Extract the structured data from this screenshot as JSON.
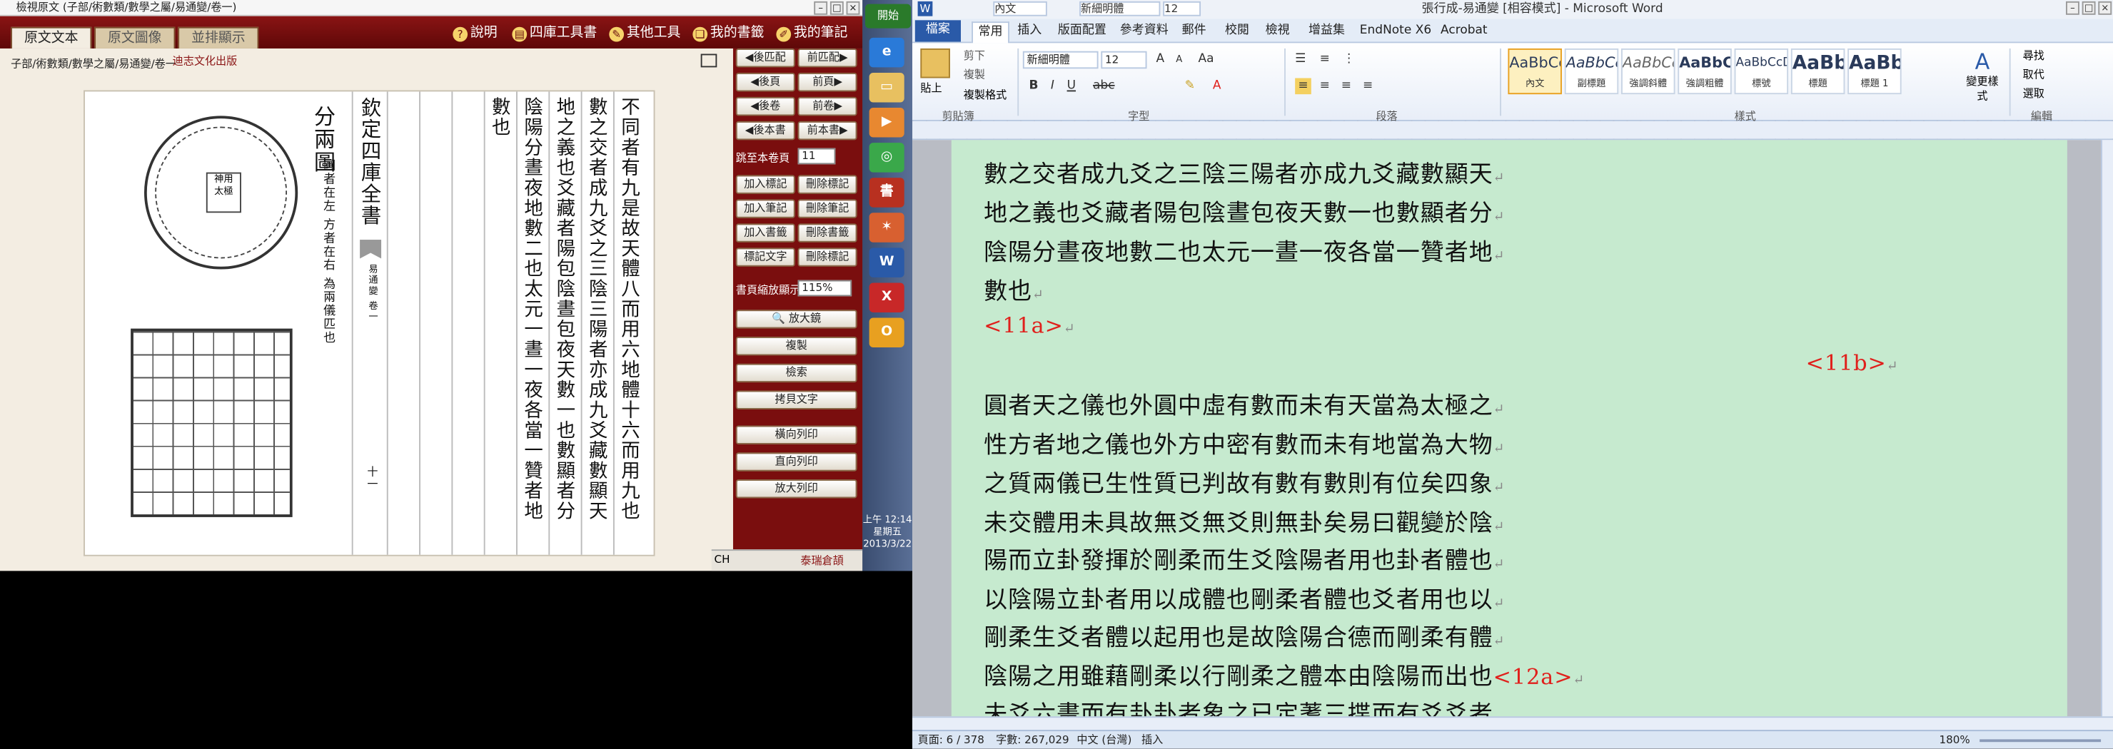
{
  "viewer": {
    "title": "檢視原文 (子部/術數類/數學之屬/易通變/卷一)",
    "tabs": [
      "原文文本",
      "原文圖像",
      "並排顯示"
    ],
    "menu": [
      {
        "icon": "help-icon",
        "label": "說明"
      },
      {
        "icon": "book-icon",
        "label": "四庫工具書"
      },
      {
        "icon": "tool-icon",
        "label": "其他工具"
      },
      {
        "icon": "bookshelf-icon",
        "label": "我的書籤"
      },
      {
        "icon": "note-icon",
        "label": "我的筆記"
      }
    ],
    "breadcrumb": "子部/術數類/數學之屬/易通變/卷一",
    "logo": "迪志文化出版",
    "page": {
      "diagram_title": "分兩圖",
      "diagram_note": "圓者在左 方者在右 為兩儀匹也",
      "seal_text": "欽定四庫全書",
      "juan_label": "易通變 卷一",
      "page_number": "十一",
      "columns": [
        "不同者有九是故天體八而用六地體十六而用九也",
        "數之交者成九爻之三陰三陽者亦成九爻藏數顯天",
        "地之義也爻藏者陽包陰晝包夜天數一也數顯者分",
        "陰陽分晝夜地數二也太元一晝一夜各當一贊者地",
        "數也"
      ]
    },
    "side": {
      "prev_match": "後匹配",
      "next_match": "前匹配",
      "prev_page": "後頁",
      "next_page": "前頁",
      "prev_juan": "後卷",
      "next_juan": "前卷",
      "prev_book": "後本書",
      "next_book": "前本書",
      "goto_label": "跳至本卷頁",
      "goto_value": "11",
      "add_bookmark": "加入標記",
      "del_bookmark": "刪除標記",
      "add_note": "加入筆記",
      "del_note": "刪除筆記",
      "add_shelf": "加入書籤",
      "del_shelf": "刪除書籤",
      "mark_text": "標記文字",
      "del_mark": "刪除標記",
      "zoom_label": "書頁縮放顯示",
      "zoom_value": "115%",
      "magnifier": "放大鏡",
      "copy": "複製",
      "search": "檢索",
      "copy_text": "拷貝文字",
      "print_h": "橫向列印",
      "print_v": "直向列印",
      "print_zoom": "放大列印"
    },
    "status": {
      "lang": "CH",
      "ime": "泰瑞倉頡"
    }
  },
  "taskbar": {
    "start": "開始",
    "clock_time": "上午 12:14",
    "clock_day": "星期五",
    "clock_date": "2013/3/22"
  },
  "word": {
    "title": "張行成-易通變 [相容模式] - Microsoft Word",
    "qat_style": "內文",
    "qat_font": "新細明體",
    "qat_size": "12",
    "tabs": [
      "檔案",
      "常用",
      "插入",
      "版面配置",
      "參考資料",
      "郵件",
      "校閱",
      "檢視",
      "增益集",
      "EndNote X6",
      "Acrobat"
    ],
    "clipboard": {
      "paste": "貼上",
      "cut": "剪下",
      "copy": "複製",
      "format": "複製格式",
      "group": "剪貼簿"
    },
    "font": {
      "name": "新細明體",
      "size": "12",
      "group": "字型"
    },
    "paragraph_group": "段落",
    "styles": [
      {
        "preview": "AaBbCcI",
        "name": "內文"
      },
      {
        "preview": "AaBbCcL",
        "name": "副標題"
      },
      {
        "preview": "AaBbCcL",
        "name": "強調斜體"
      },
      {
        "preview": "AaBbCcI",
        "name": "強調粗體"
      },
      {
        "preview": "AaBbCcDd",
        "name": "標號"
      },
      {
        "preview": "AaBb",
        "name": "標題"
      },
      {
        "preview": "AaBb",
        "name": "標題 1"
      }
    ],
    "styles_group": "樣式",
    "change_styles": "變更樣式",
    "editing": {
      "find": "尋找",
      "replace": "取代",
      "select": "選取",
      "group": "編輯"
    },
    "doc_lines": [
      "數之交者成九爻之三陰三陽者亦成九爻藏數顯天",
      "地之義也爻藏者陽包陰晝包夜天數一也數顯者分",
      "陰陽分晝夜地數二也太元一晝一夜各當一贊者地",
      "數也"
    ],
    "marker_11a": "<11a>",
    "marker_11b": "<11b>",
    "doc_lines2": [
      "圓者天之儀也外圓中虛有數而未有天當為太極之",
      "性方者地之儀也外方中密有數而未有地當為大物",
      "之質兩儀已生性質已判故有數有數則有位矣四象",
      "未交體用未具故無爻無爻則無卦矣易曰觀變於陰",
      "陽而立卦發揮於剛柔而生爻陰陽者用也卦者體也",
      "以陰陽立卦者用以成體也剛柔者體也爻者用也以",
      "剛柔生爻者體以起用也是故陰陽合德而剛柔有體",
      "陰陽之用雖藉剛柔以行剛柔之體本由陰陽而出也",
      "未爻六畫而有卦卦者象之已定蓍三揲而有爻爻者"
    ],
    "marker_12a": "<12a>",
    "status": {
      "page": "頁面: 6 / 378",
      "words": "字數: 267,029",
      "lang": "中文 (台灣)",
      "mode": "插入",
      "zoom": "180%"
    }
  }
}
